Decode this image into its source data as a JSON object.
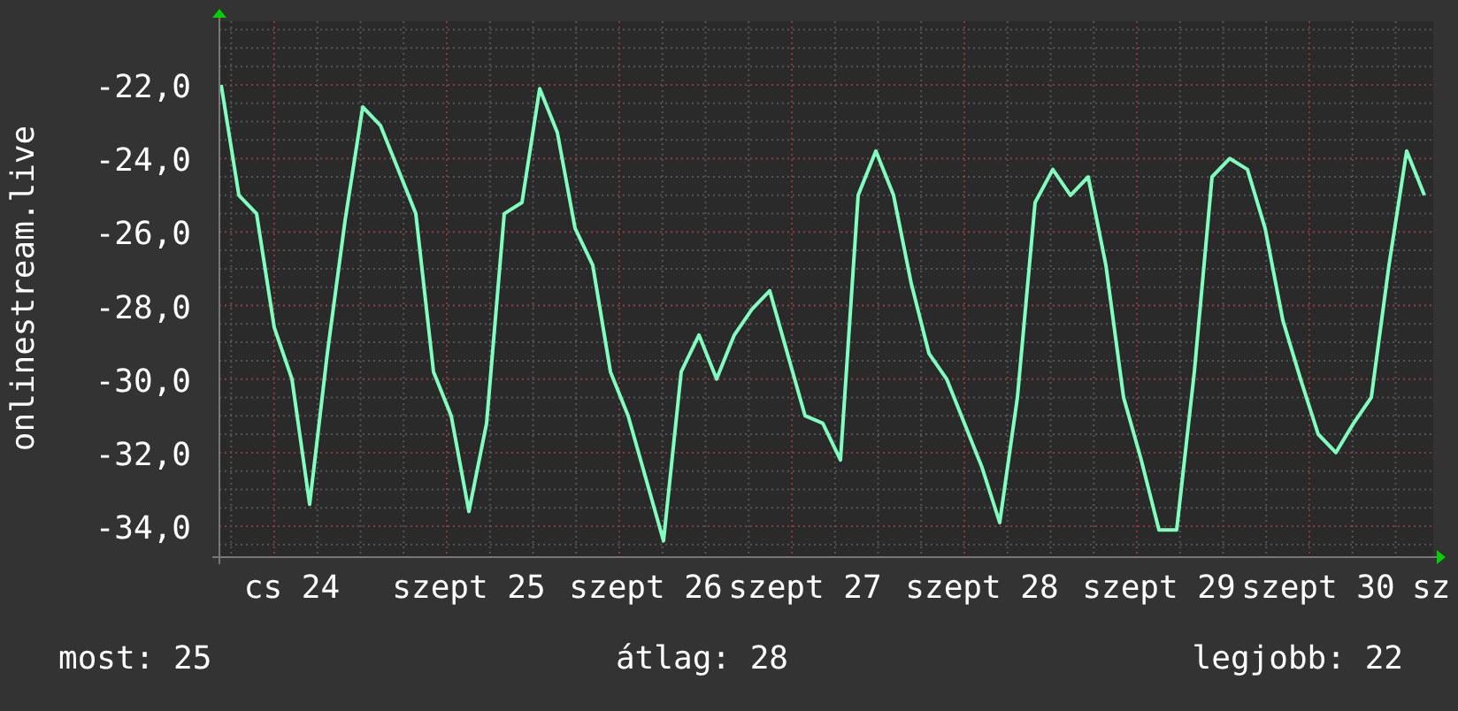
{
  "chart": {
    "chart_data": {
      "type": "line",
      "ylabel": "onlinestream.live",
      "ylim": [
        -34.84,
        -20.27
      ],
      "grid": true,
      "categories": [
        null,
        null,
        null,
        null,
        "cs 24",
        null,
        null,
        null,
        null,
        null,
        null,
        null,
        null,
        null,
        "szept 25",
        null,
        null,
        null,
        null,
        null,
        null,
        null,
        null,
        null,
        "szept 26",
        null,
        null,
        null,
        null,
        null,
        null,
        null,
        null,
        "szept 27",
        null,
        null,
        null,
        null,
        null,
        null,
        null,
        null,
        null,
        "szept 28",
        null,
        null,
        null,
        null,
        null,
        null,
        null,
        null,
        null,
        "szept 29",
        null,
        null,
        null,
        null,
        null,
        null,
        null,
        null,
        "szept 30",
        null,
        null,
        null,
        null,
        null,
        null
      ],
      "yticks": [
        {
          "value": -34,
          "label": "-34,0"
        },
        {
          "value": -32,
          "label": "-32,0"
        },
        {
          "value": -30,
          "label": "-30,0"
        },
        {
          "value": -28,
          "label": "-28,0"
        },
        {
          "value": -26,
          "label": "-26,0"
        },
        {
          "value": -24,
          "label": "-24,0"
        },
        {
          "value": -22,
          "label": "-22,0"
        }
      ],
      "series": [
        {
          "color": "#80ffbf",
          "values": [
            -22.0,
            -25.0,
            -25.5,
            -28.6,
            -30.0,
            -33.4,
            -29.3,
            -25.7,
            -22.6,
            -23.1,
            -24.3,
            -25.5,
            -29.8,
            -31.0,
            -33.6,
            -31.2,
            -25.5,
            -25.2,
            -22.1,
            -23.3,
            -25.9,
            -26.9,
            -29.8,
            -31.0,
            -32.7,
            -34.4,
            -29.8,
            -28.8,
            -30.0,
            -28.8,
            -28.1,
            -27.6,
            -29.3,
            -31.0,
            -31.2,
            -32.2,
            -25.0,
            -23.8,
            -25.0,
            -27.4,
            -29.3,
            -30.0,
            -31.2,
            -32.4,
            -33.9,
            -30.5,
            -25.2,
            -24.3,
            -25.0,
            -24.5,
            -26.9,
            -30.5,
            -32.2,
            -34.1,
            -34.1,
            -29.8,
            -24.5,
            -24.0,
            -24.3,
            -25.9,
            -28.4,
            -30.0,
            -31.5,
            -32.0,
            -31.2,
            -30.5,
            -26.9,
            -23.8,
            -25.0
          ]
        }
      ]
    },
    "cut_axis_label": "sz"
  },
  "stats": [
    "most: 25",
    "átlag: 28",
    "legjobb: 22"
  ]
}
